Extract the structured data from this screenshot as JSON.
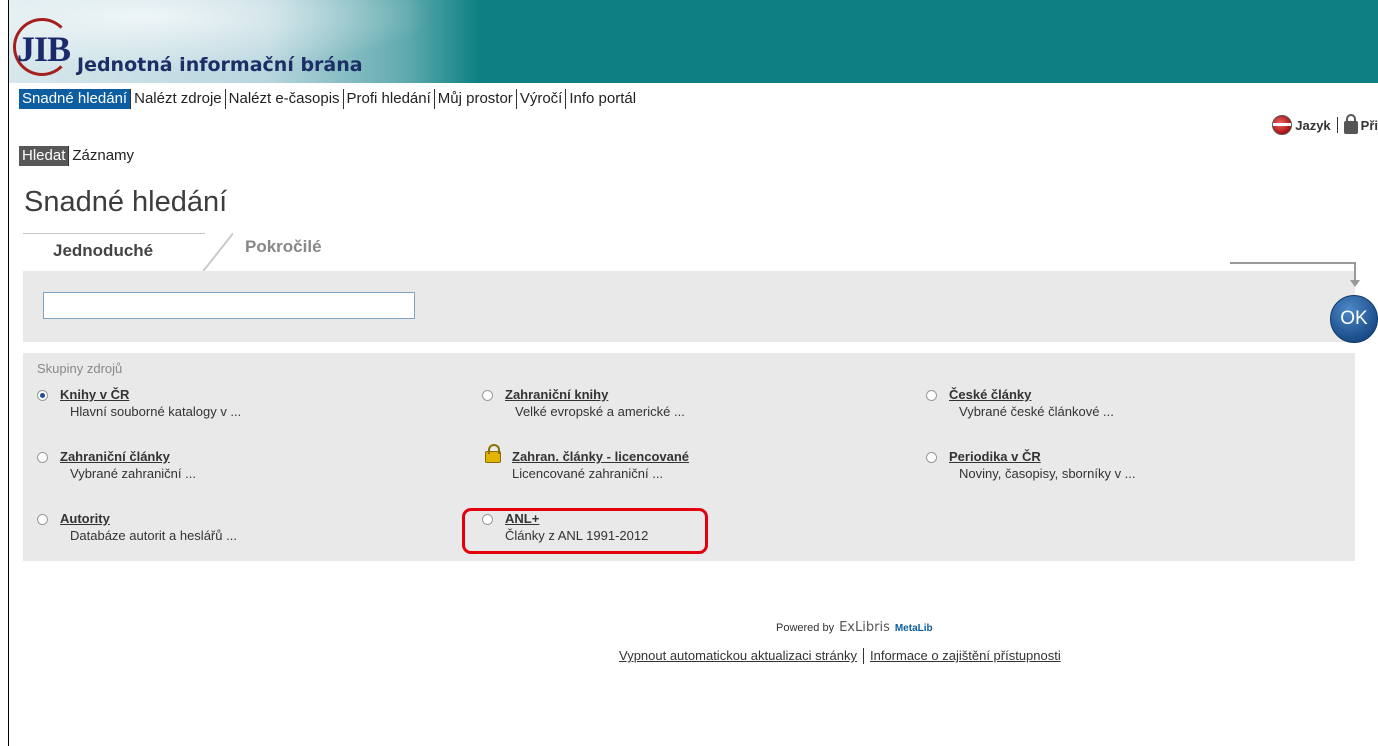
{
  "banner": {
    "logo_text": "JIB",
    "title": "Jednotná informační brána"
  },
  "nav": {
    "items": [
      {
        "label": "Snadné hledání",
        "active": true
      },
      {
        "label": "Nalézt zdroje"
      },
      {
        "label": "Nalézt e-časopis"
      },
      {
        "label": "Profi hledání"
      },
      {
        "label": "Můj prostor"
      },
      {
        "label": "Výročí"
      },
      {
        "label": "Info portál"
      }
    ]
  },
  "userbar": {
    "language": "Jazyk",
    "login": "Při"
  },
  "subnav": {
    "items": [
      {
        "label": "Hledat",
        "active": true
      },
      {
        "label": "Záznamy"
      }
    ]
  },
  "page_title": "Snadné hledání",
  "tabs": {
    "simple": "Jednoduché",
    "advanced": "Pokročilé"
  },
  "search": {
    "value": "",
    "ok_label": "OK"
  },
  "groups": {
    "title": "Skupiny zdrojů",
    "items": [
      {
        "label": "Knihy v ČR",
        "desc": "Hlavní souborné katalogy v ...",
        "checked": true
      },
      {
        "label": "Zahraniční knihy",
        "desc": "Velké evropské a americké ..."
      },
      {
        "label": "České články",
        "desc": "Vybrané české článkové ..."
      },
      {
        "label": "Zahraniční články",
        "desc": "Vybrané zahraniční ..."
      },
      {
        "label": "Zahran. články - licencované",
        "desc": "Licencované zahraniční ...",
        "locked": true
      },
      {
        "label": "Periodika v ČR",
        "desc": "Noviny, časopisy, sborníky v ..."
      },
      {
        "label": "Autority",
        "desc": "Databáze autorit a heslářů ..."
      },
      {
        "label": "ANL+",
        "desc": "Články z ANL 1991-2012",
        "highlighted": true
      }
    ]
  },
  "footer": {
    "powered_by": "Powered by",
    "exlibris": "ExLibris",
    "metalib": "MetaLib",
    "link_refresh": "Vypnout automatickou aktualizaci stránky",
    "link_accessibility": "Informace o zajištění přístupnosti"
  },
  "colors": {
    "banner": "#0c8082",
    "accent": "#0d5ea0",
    "highlight": "#e2000a"
  }
}
